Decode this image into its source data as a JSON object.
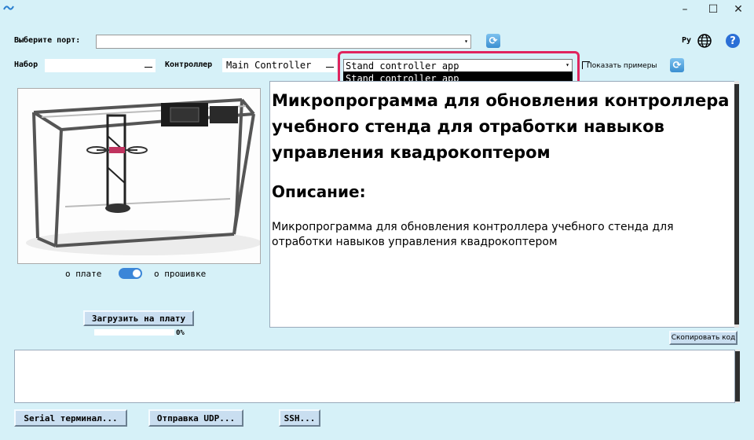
{
  "titlebar": {
    "app_icon": "app-logo-icon",
    "minimize": "–",
    "maximize": "☐",
    "close": "✕"
  },
  "port": {
    "label": "Выберите порт:",
    "value": ""
  },
  "language": {
    "label": "Ру",
    "icon": "globe-icon"
  },
  "help": {
    "icon": "help-icon",
    "glyph": "?"
  },
  "set": {
    "label": "Набор",
    "value": ""
  },
  "controller": {
    "label": "Контроллер",
    "value": "Main Controller"
  },
  "firmware_select": {
    "value": "Stand controller app"
  },
  "dropdown": {
    "items": [
      "Stand controller app"
    ]
  },
  "show_examples": {
    "label": "Показать примеры"
  },
  "toggle": {
    "left_label": "о плате",
    "right_label": "о прошивке"
  },
  "upload": {
    "label": "Загрузить на плату",
    "progress_text": "0%",
    "progress": 0
  },
  "description": {
    "title": "Микропрограмма для обновления контроллера учебного стенда для отработки навыков управления квадрокоптером",
    "heading": "Описание:",
    "text": "Микропрограмма для обновления контроллера учебного стенда для отработки навыков управления квадрокоптером"
  },
  "copy_code": {
    "label": "Скопировать код"
  },
  "bottom_buttons": {
    "serial": "Serial терминал...",
    "udp": "Отправка UDP...",
    "ssh": "SSH..."
  },
  "colors": {
    "background": "#d6f1f8",
    "highlight": "#e0245e",
    "accent": "#3b86d8"
  }
}
